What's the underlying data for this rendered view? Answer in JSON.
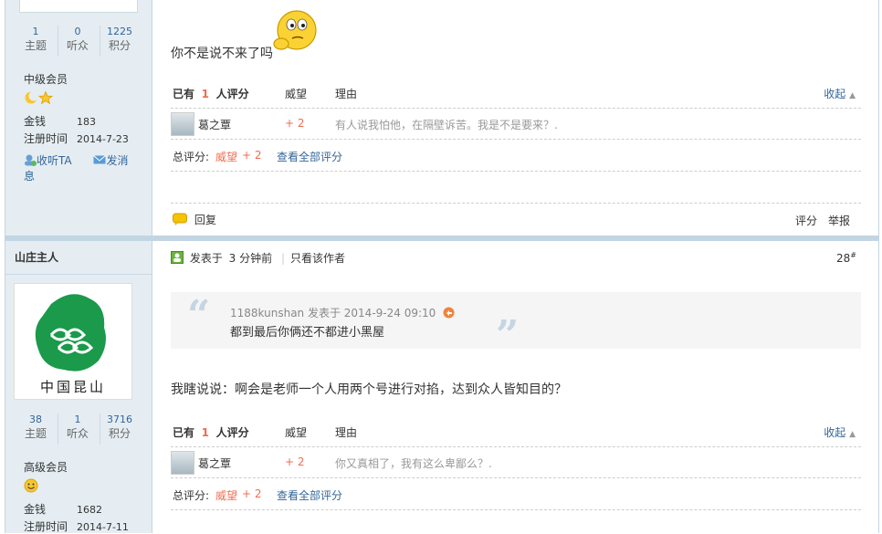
{
  "post1": {
    "author": {
      "stats": [
        {
          "num": "1",
          "label": "主题"
        },
        {
          "num": "0",
          "label": "听众"
        },
        {
          "num": "1225",
          "label": "积分"
        }
      ],
      "group": "中级会员",
      "money_label": "金钱",
      "money": "183",
      "reg_label": "注册时间",
      "reg_date": "2014-7-23",
      "follow": "收听TA",
      "message": "发消息"
    },
    "text": "你不是说不来了吗",
    "rating": {
      "head_prefix": "已有",
      "count": "1",
      "head_suffix": "人评分",
      "col_weiwang": "威望",
      "col_reason": "理由",
      "collapse": "收起",
      "rater_name": "葛之覃",
      "rater_score": "+ 2",
      "rater_reason": "有人说我怕他，在隔壁诉苦。我是不是要来？.",
      "total_label": "总评分:",
      "total_item": "威望",
      "total_score": "+ 2",
      "view_all": "查看全部评分"
    },
    "reply": "回复",
    "rate": "评分",
    "report": "举报"
  },
  "post2": {
    "author": {
      "name": "山庄主人",
      "logo_text": "中国昆山",
      "stats": [
        {
          "num": "38",
          "label": "主题"
        },
        {
          "num": "1",
          "label": "听众"
        },
        {
          "num": "3716",
          "label": "积分"
        }
      ],
      "group": "高级会员",
      "money_label": "金钱",
      "money": "1682",
      "reg_label": "注册时间",
      "reg_date": "2014-7-11"
    },
    "posted_prefix": "发表于",
    "posted_time": "3 分钟前",
    "only_author": "只看该作者",
    "floor": "28",
    "quote": {
      "author_line": "1188kunshan 发表于 2014-9-24 09:10",
      "text": "都到最后你俩还不都进小黑屋"
    },
    "text": "我瞎说说：啊会是老师一个人用两个号进行对掐，达到众人皆知目的？",
    "rating": {
      "head_prefix": "已有",
      "count": "1",
      "head_suffix": "人评分",
      "col_weiwang": "威望",
      "col_reason": "理由",
      "collapse": "收起",
      "rater_name": "葛之覃",
      "rater_score": "+ 2",
      "rater_reason": "你又真相了，我有这么卑鄙么？.",
      "total_label": "总评分:",
      "total_item": "威望",
      "total_score": "+ 2",
      "view_all": "查看全部评分"
    }
  },
  "colors": {
    "accent": "#336699",
    "score": "#f26c4f",
    "side_bg": "#e5edf2",
    "border": "#c2d5e3"
  }
}
